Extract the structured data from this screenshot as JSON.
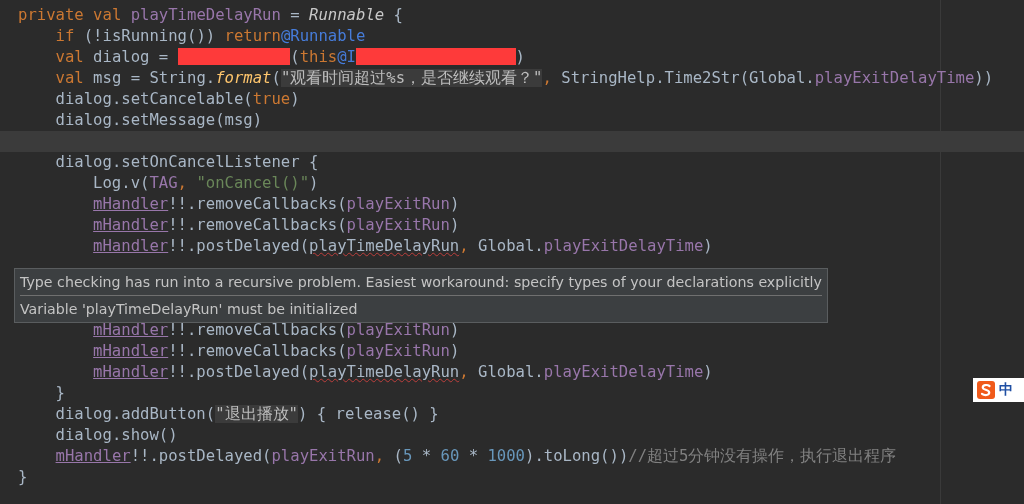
{
  "editor": {
    "lines": [
      {
        "tokens": [
          {
            "kind": "keyword",
            "text": "private val "
          },
          {
            "kind": "field",
            "text": "playTimeDelayRun"
          },
          {
            "kind": "plain",
            "text": " = "
          },
          {
            "kind": "type",
            "text": "Runnable"
          },
          {
            "kind": "plain",
            "text": " {"
          }
        ],
        "children": [
          {
            "tokens": [
              {
                "kind": "keyword",
                "text": "if "
              },
              {
                "kind": "plain",
                "text": "(!isRunning()) "
              },
              {
                "kind": "keyword",
                "text": "return"
              },
              {
                "kind": "label",
                "text": "@Runnable"
              }
            ]
          },
          {
            "tokens": [
              {
                "kind": "keyword",
                "text": "val "
              },
              {
                "kind": "plain",
                "text": "dialog = "
              },
              {
                "kind": "redaction"
              },
              {
                "kind": "plain",
                "text": "("
              },
              {
                "kind": "keyword",
                "text": "this"
              },
              {
                "kind": "label",
                "text": "@I"
              },
              {
                "kind": "long_redaction"
              },
              {
                "kind": "plain",
                "text": ")"
              }
            ]
          },
          {
            "tokens": [
              {
                "kind": "keyword",
                "text": "val "
              },
              {
                "kind": "plain",
                "text": "msg = String."
              },
              {
                "kind": "call",
                "text": "format"
              },
              {
                "kind": "plain",
                "text": "("
              },
              {
                "kind": "injected",
                "text": "\"观看时间超过%s，是否继续观看？\""
              },
              {
                "kind": "keyword",
                "text": ", "
              },
              {
                "kind": "plain",
                "text": "StringHelp.Time2Str(Global."
              },
              {
                "kind": "field",
                "text": "playExitDelayTime"
              },
              {
                "kind": "plain",
                "text": "))"
              }
            ]
          },
          {
            "tokens": [
              {
                "kind": "plain",
                "text": "dialog.setCancelable("
              },
              {
                "kind": "keyword",
                "text": "true"
              },
              {
                "kind": "plain",
                "text": ")"
              }
            ]
          },
          {
            "tokens": [
              {
                "kind": "plain",
                "text": "dialog.setMessage(msg)"
              }
            ]
          },
          {
            "current": true
          },
          {
            "tokens": [
              {
                "kind": "plain",
                "text": "dialog.setOnCancelListener {"
              }
            ],
            "children": [
              {
                "tokens": [
                  {
                    "kind": "plain",
                    "text": "Log.v("
                  },
                  {
                    "kind": "field",
                    "text": "TAG"
                  },
                  {
                    "kind": "keyword",
                    "text": ", "
                  },
                  {
                    "kind": "string",
                    "text": "\"onCancel()\""
                  },
                  {
                    "kind": "plain",
                    "text": ")"
                  }
                ]
              },
              {
                "tokens": [
                  {
                    "kind": "member",
                    "text": "mHandler"
                  },
                  {
                    "kind": "plain",
                    "text": "!!.removeCallbacks("
                  },
                  {
                    "kind": "field",
                    "text": "playExitRun"
                  },
                  {
                    "kind": "plain",
                    "text": ")"
                  }
                ]
              },
              {
                "tokens": [
                  {
                    "kind": "member",
                    "text": "mHandler"
                  },
                  {
                    "kind": "plain",
                    "text": "!!.removeCallbacks("
                  },
                  {
                    "kind": "field",
                    "text": "playExitRun"
                  },
                  {
                    "kind": "plain",
                    "text": ")"
                  }
                ]
              },
              {
                "tokens": [
                  {
                    "kind": "member",
                    "text": "mHandler"
                  },
                  {
                    "kind": "plain",
                    "text": "!!.postDelayed("
                  },
                  {
                    "kind": "error",
                    "text": "playTimeDelayRun"
                  },
                  {
                    "kind": "keyword",
                    "text": ", "
                  },
                  {
                    "kind": "plain",
                    "text": "Global."
                  },
                  {
                    "kind": "field",
                    "text": "playExitDelayTime"
                  },
                  {
                    "kind": "plain",
                    "text": ")"
                  }
                ]
              }
            ]
          },
          {
            "children": [
              {
                "tokens": [
                  {
                    "kind": "member",
                    "text": "mHandler"
                  },
                  {
                    "kind": "plain",
                    "text": "!!.removeCallbacks("
                  },
                  {
                    "kind": "field",
                    "text": "playExitRun"
                  },
                  {
                    "kind": "plain",
                    "text": ")"
                  }
                ]
              },
              {
                "tokens": [
                  {
                    "kind": "member",
                    "text": "mHandler"
                  },
                  {
                    "kind": "plain",
                    "text": "!!.removeCallbacks("
                  },
                  {
                    "kind": "field",
                    "text": "playExitRun"
                  },
                  {
                    "kind": "plain",
                    "text": ")"
                  }
                ]
              },
              {
                "tokens": [
                  {
                    "kind": "member",
                    "text": "mHandler"
                  },
                  {
                    "kind": "plain",
                    "text": "!!.postDelayed("
                  },
                  {
                    "kind": "error",
                    "text": "playTimeDelayRun"
                  },
                  {
                    "kind": "keyword",
                    "text": ", "
                  },
                  {
                    "kind": "plain",
                    "text": "Global."
                  },
                  {
                    "kind": "field",
                    "text": "playExitDelayTime"
                  },
                  {
                    "kind": "plain",
                    "text": ")"
                  }
                ]
              }
            ]
          },
          {
            "tokens": [
              {
                "kind": "plain",
                "text": "}"
              }
            ]
          },
          {
            "tokens": [
              {
                "kind": "plain",
                "text": "dialog.addButton("
              },
              {
                "kind": "injected",
                "text": "\"退出播放\""
              },
              {
                "kind": "plain",
                "text": ") { release() }"
              }
            ]
          },
          {
            "tokens": [
              {
                "kind": "plain",
                "text": "dialog.show()"
              }
            ]
          },
          {
            "tokens": [
              {
                "kind": "member",
                "text": "mHandler"
              },
              {
                "kind": "plain",
                "text": "!!.postDelayed("
              },
              {
                "kind": "field",
                "text": "playExitRun"
              },
              {
                "kind": "keyword",
                "text": ", "
              },
              {
                "kind": "plain",
                "text": "("
              },
              {
                "kind": "number",
                "text": "5"
              },
              {
                "kind": "plain",
                "text": " * "
              },
              {
                "kind": "number",
                "text": "60"
              },
              {
                "kind": "plain",
                "text": " * "
              },
              {
                "kind": "number",
                "text": "1000"
              },
              {
                "kind": "plain",
                "text": ").toLong())"
              },
              {
                "kind": "comment",
                "text": "//超过5分钟没有操作，执行退出程序"
              }
            ]
          }
        ]
      },
      {
        "tokens": [
          {
            "kind": "plain",
            "text": "}"
          }
        ]
      }
    ]
  },
  "tooltip": {
    "messages": [
      "Type checking has run into a recursive problem. Easiest workaround: specify types of your declarations explicitly",
      "Variable 'playTimeDelayRun' must be initialized"
    ]
  },
  "ime": {
    "mode": "中"
  }
}
